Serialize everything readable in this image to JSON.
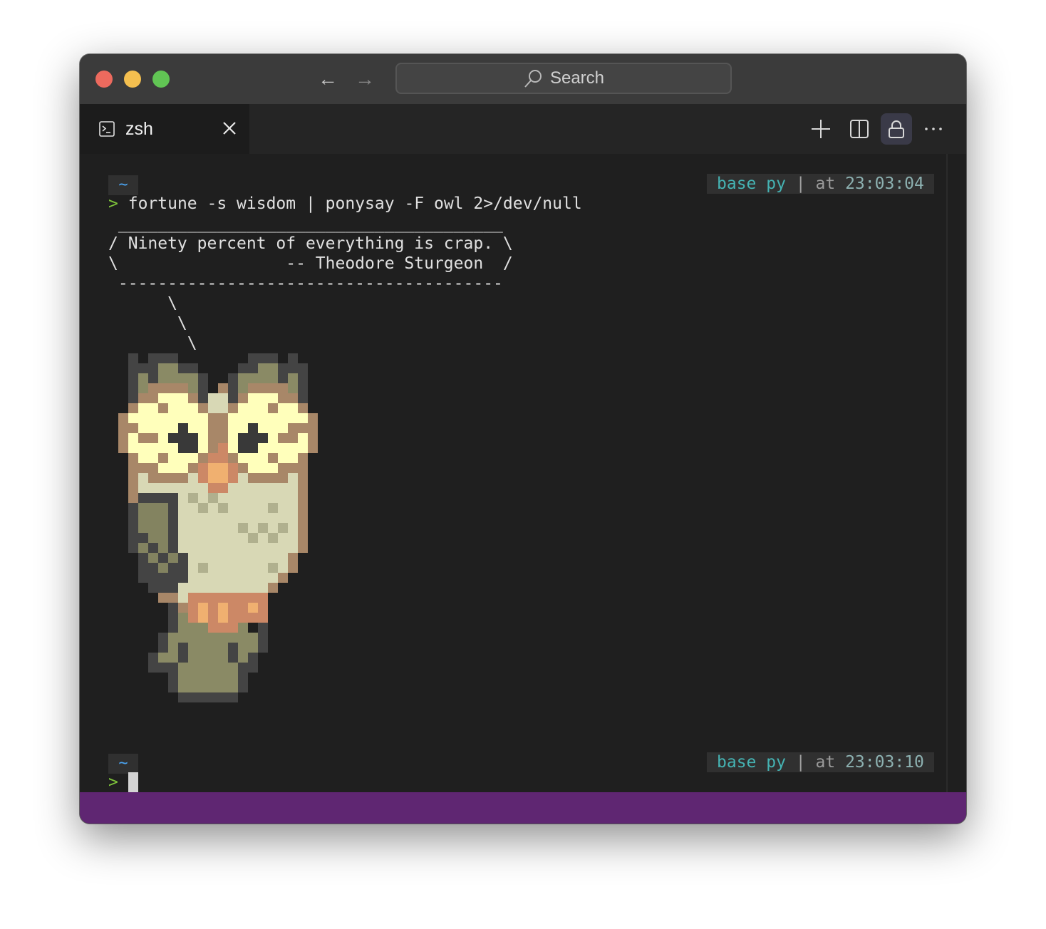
{
  "window": {
    "traffic_lights": [
      "close",
      "minimize",
      "zoom"
    ],
    "nav": {
      "back_icon": "←",
      "forward_icon": "→"
    },
    "search": {
      "placeholder": "Search"
    }
  },
  "tabs": [
    {
      "label": "zsh",
      "icon": "terminal-icon",
      "active": true
    }
  ],
  "toolbar": {
    "new_tab": "plus-icon",
    "split": "split-pane-icon",
    "lock": "lock-icon",
    "more": "more-icon"
  },
  "terminal": {
    "block1": {
      "dir": "~",
      "prompt_symbol": ">",
      "command": "fortune -s wisdom | ponysay -F owl 2>/dev/null",
      "right_prompt": {
        "env": "base py",
        "sep": "|",
        "at": "at",
        "time": "23:03:04"
      },
      "output": [
        " _______________________________________ ",
        "/ Ninety percent of everything is crap. \\",
        "\\                 -- Theodore Sturgeon  /",
        " --------------------------------------- ",
        "      \\",
        "       \\",
        "        \\"
      ]
    },
    "owl": {
      "palette": {
        "D": "#444444",
        "O": "#8a8a65",
        "G": "#838360",
        "B": "#a88768",
        "Y": "#ffffbb",
        "C": "#d8d8b5",
        "K": "#393939",
        "R": "#cc8866",
        "P": "#f0b070",
        "S": "#b0b08e"
      },
      "rows": [
        ".D.DDD.......DDD.D..",
        ".DDDOODD....DDOODDD.",
        ".DODOOOOD..DOOOODOD.",
        ".DOBBBBOD.BDOBBBBOD.",
        ".DBBYYYBDCCDBYYYBBD.",
        ".BYYBYYYBCCBYYYBYYB.",
        "BYYYYYYYYBBYYYYYYYYB",
        "BBYYYYKYYBBYYKYYYBBB",
        "BYBBYKKKYBBYKKKYBBYB",
        "BYYYYYKKYBRYKKYYYYYB",
        ".BYYBYYYBRRBYYYBYYB.",
        ".BBBYYYBRPPRBYYYBBB.",
        ".BCBBBBCRPPRCBBBBCB.",
        ".BCCCCCCCRRCCCCCCCB.",
        ".BDDDDCSCSCCCCCCCCB.",
        ".DGGGDCCSCSCCCCSCCB.",
        ".DGGGDCCCCCCCCCCCCB.",
        ".DGGGDCCCCCCSCSCSCB.",
        ".DDGGDCCCCCCCSCSCCB.",
        ".DGDGDCCCCCCCCCCCCB.",
        "..DGDGDCCCCCCCCCCB..",
        "..DDGDDCSCCCCCCSCB..",
        "..DDDDDCCCCCCCCCB...",
        "...DDDCCCCCCCCCB....",
        "....BBCRRRRRRRR.....",
        ".....DBRPRPRRPR.....",
        ".....DORPRPRRRR.....",
        ".....DOOORRRO.D.....",
        "....DOOOOOOOOOD.....",
        "....DODOOOODOOD.....",
        "...DOODOOOODOD......",
        "...DDDOOOOOODD......",
        ".....DOOOOOOD.......",
        ".....DOOOOOOD.......",
        "......DDDDDD........"
      ]
    },
    "block2": {
      "dir": "~",
      "prompt_symbol": ">",
      "command": "",
      "right_prompt": {
        "env": "base py",
        "sep": "|",
        "at": "at",
        "time": "23:03:10"
      }
    }
  },
  "statusbar": {
    "color": "#5f2672"
  }
}
